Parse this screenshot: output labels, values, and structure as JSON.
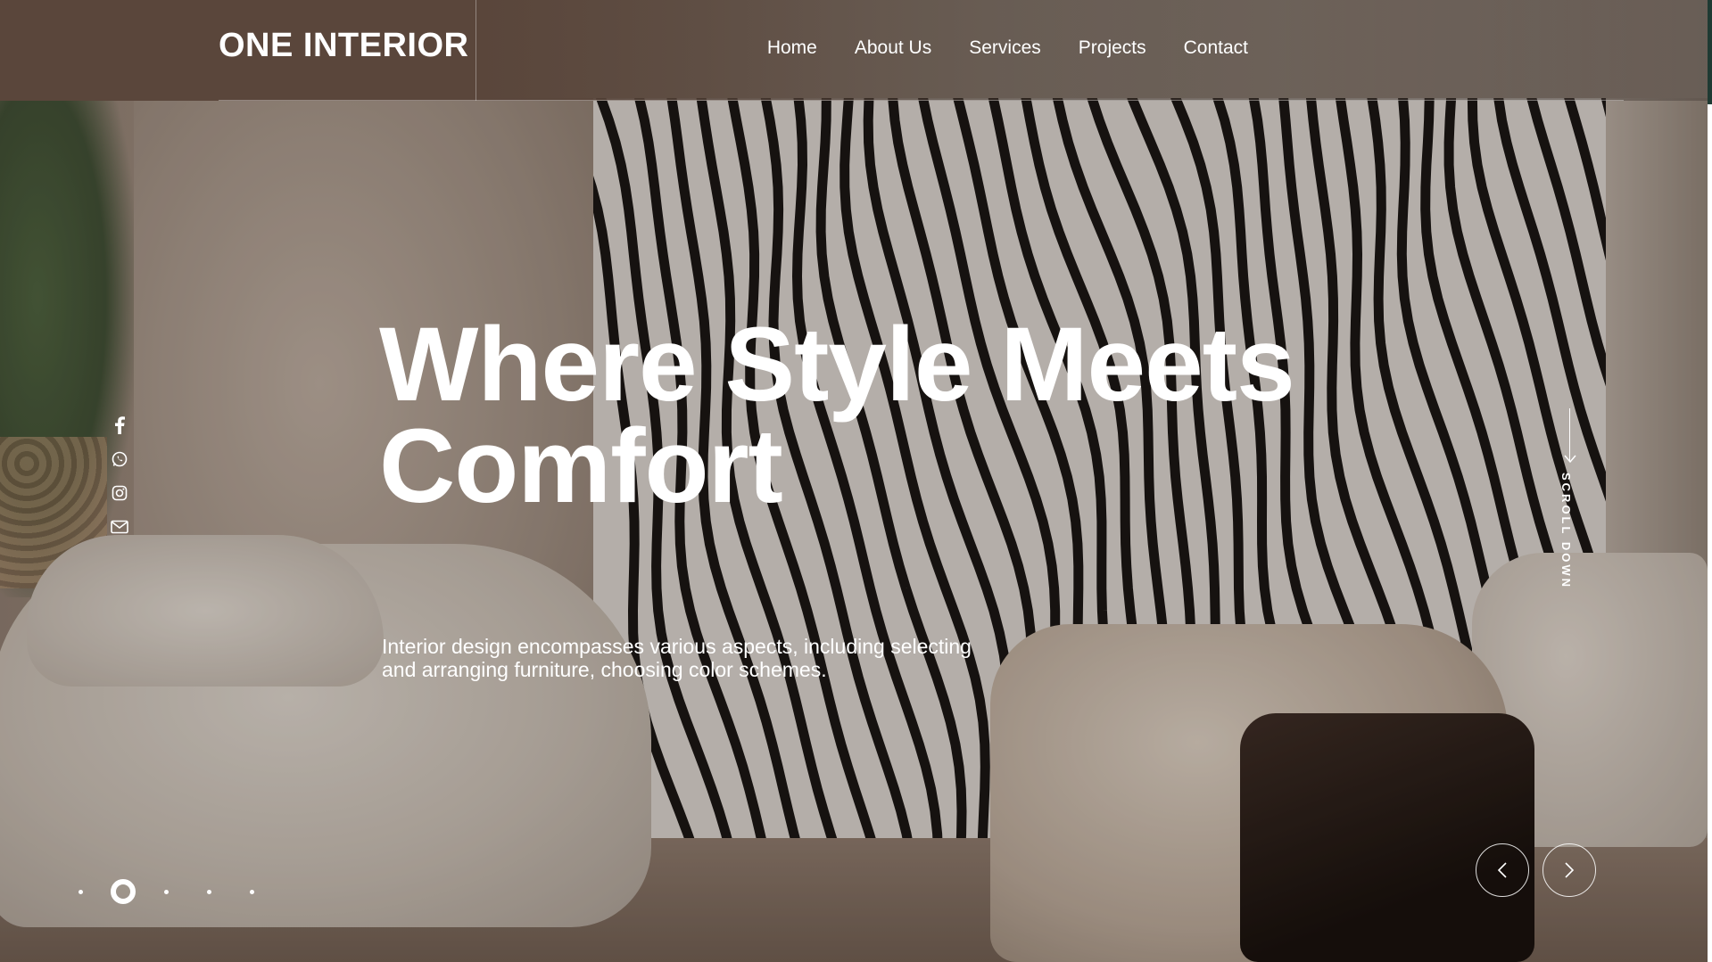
{
  "brand": {
    "logo_text": "ONE INTERIOR"
  },
  "nav": {
    "items": [
      {
        "label": "Home"
      },
      {
        "label": "About Us"
      },
      {
        "label": "Services"
      },
      {
        "label": "Projects"
      },
      {
        "label": "Contact"
      }
    ]
  },
  "hero": {
    "headline_line1": "Where Style Meets",
    "headline_line2": "Comfort",
    "subtext": "Interior design encompasses various aspects, including selecting and arranging furniture, choosing color schemes."
  },
  "social": {
    "icons": [
      "facebook-icon",
      "whatsapp-icon",
      "instagram-icon",
      "mail-icon"
    ]
  },
  "scroll": {
    "label": "SCROLL DOWN"
  },
  "slider": {
    "prev_icon": "chevron-left-icon",
    "next_icon": "chevron-right-icon",
    "slide_count": 5,
    "active_index": 1
  },
  "colors": {
    "header_bg": "#5a463b",
    "text": "#ffffff",
    "edge_accent": "#1f3a33"
  }
}
